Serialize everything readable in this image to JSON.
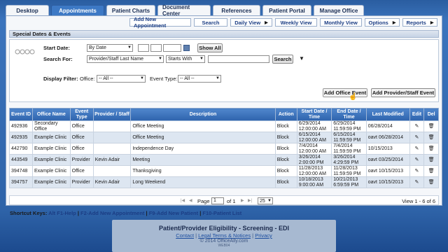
{
  "tabs": [
    "Desktop",
    "Appointments",
    "Patient Charts",
    "Document Center",
    "References",
    "Patient Portal",
    "Manage Office"
  ],
  "active_tab": "Appointments",
  "subnav": [
    {
      "label": "Add New Appointment",
      "arrow": ""
    },
    {
      "label": "Search",
      "arrow": ""
    },
    {
      "label": "Daily View",
      "arrow": "▶"
    },
    {
      "label": "Weekly View",
      "arrow": ""
    },
    {
      "label": "Monthly View",
      "arrow": ""
    },
    {
      "label": "Options",
      "arrow": "▶"
    },
    {
      "label": "Reports",
      "arrow": "▶"
    }
  ],
  "section_title": "Special Dates & Events",
  "filters": {
    "start_date_label": "Start Date:",
    "start_date_mode": "By Date",
    "show_all": "Show All",
    "search_for_label": "Search For:",
    "search_field": "Provider/Staff Last Name",
    "search_match": "Starts With",
    "search_button": "Search",
    "display_filter_label": "Display Filter:",
    "office_label": "Office:",
    "office_value": "-- All --",
    "event_type_label": "Event Type:",
    "event_type_value": "-- All --",
    "add_office_event": "Add Office Event",
    "add_provider_event": "Add Provider/Staff Event"
  },
  "table": {
    "headers": [
      "Event ID",
      "Office Name",
      "Event Type",
      "Provider / Staff",
      "Description",
      "Action",
      "Start Date / Time",
      "End Date / Time",
      "Last Modified",
      "Edit",
      "Del"
    ],
    "rows": [
      [
        "492936",
        "Secondary Office",
        "Office",
        "",
        "Office Meeting",
        "Block",
        "6/29/2014 12:00:00 AM",
        "6/29/2014 11:59:59 PM",
        "06/28/2014"
      ],
      [
        "492935",
        "Example Clinic",
        "Office",
        "",
        "Office Meeting",
        "Block",
        "6/15/2014 12:00:00 AM",
        "6/15/2014 11:59:59 PM",
        "oavt 06/28/2014"
      ],
      [
        "442790",
        "Example Clinic",
        "Office",
        "",
        "Independence Day",
        "Block",
        "7/4/2014 12:00:00 AM",
        "7/4/2014 11:59:59 PM",
        "10/15/2013"
      ],
      [
        "443549",
        "Example Clinic",
        "Provider",
        "Kevin Adair",
        "Meeting",
        "Block",
        "3/26/2014 2:00:00 PM",
        "3/26/2014 4:29:59 PM",
        "oavt 03/25/2014"
      ],
      [
        "394748",
        "Example Clinic",
        "Office",
        "",
        "Thanksgiving",
        "Block",
        "11/28/2013 12:00:00 AM",
        "11/28/2013 11:59:59 PM",
        "oavt 10/15/2013"
      ],
      [
        "394757",
        "Example Clinic",
        "Provider",
        "Kevin Adair",
        "Long Weekend",
        "Block",
        "10/18/2013 9:00:00 AM",
        "10/21/2013 6:59:59 PM",
        "oavt 10/15/2013"
      ]
    ]
  },
  "pager": {
    "page_label": "Page",
    "page_value": "1",
    "of_label": "of 1",
    "per_page": "25",
    "view_text": "View 1 - 6 of 6"
  },
  "shortcuts": {
    "label": "Shortcut Keys:",
    "items": [
      "Alt F1-Help",
      "F2-Add New Appointment",
      "F9-Add New Patient",
      "F10-Patient List"
    ]
  },
  "footer": {
    "title": "Patient/Provider Eligibility - Screening - EDI",
    "links": [
      "Contact",
      "Legal Terms & Notices",
      "Privacy"
    ],
    "copyright": "© 2014 OfficeAlly.com",
    "server": "WEB04"
  },
  "colors": {
    "header_blue": "#3d79c5",
    "row_alt": "#dde6f1",
    "link": "#1b3d84"
  }
}
